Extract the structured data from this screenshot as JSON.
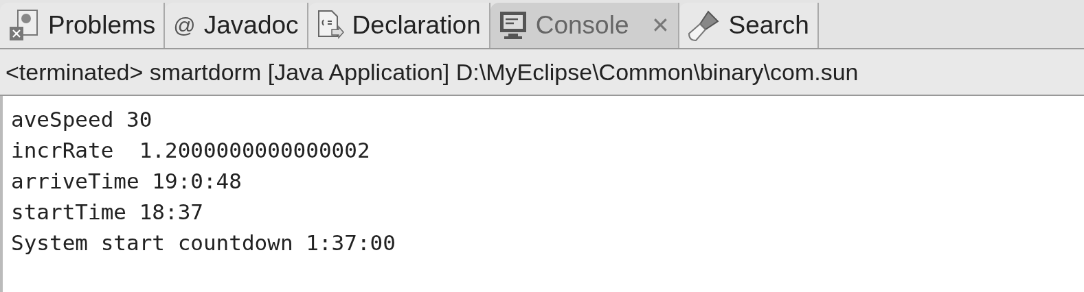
{
  "tabs": [
    {
      "kind": "problems",
      "label": "Problems",
      "selected": false
    },
    {
      "kind": "javadoc",
      "icon_text": "@",
      "label": "Javadoc",
      "selected": false
    },
    {
      "kind": "declaration",
      "label": "Declaration",
      "selected": false
    },
    {
      "kind": "console",
      "label": "Console",
      "selected": true,
      "close": "✕"
    },
    {
      "kind": "search",
      "label": "Search",
      "selected": false
    }
  ],
  "console": {
    "header": "<terminated> smartdorm [Java Application] D:\\MyEclipse\\Common\\binary\\com.sun",
    "lines": [
      "aveSpeed 30",
      "incrRate  1.2000000000000002",
      "arriveTime 19:0:48",
      "startTime 18:37",
      "System start countdown 1:37:00"
    ]
  }
}
